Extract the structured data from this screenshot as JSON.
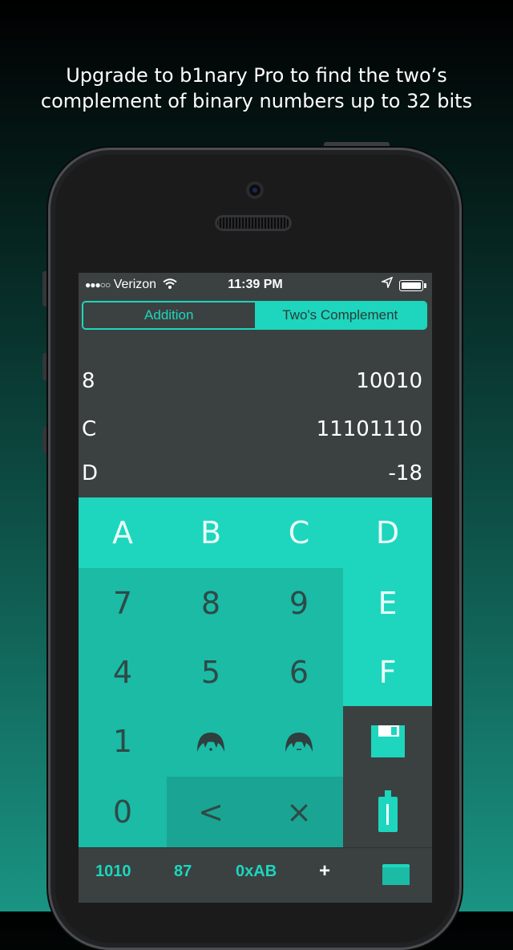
{
  "promo": {
    "line1": "Upgrade to b1nary Pro to find the two’s",
    "line2": "complement of binary numbers up to 32 bits"
  },
  "status_bar": {
    "signal": "●●●○○",
    "carrier": "Verizon",
    "time": "11:39 PM"
  },
  "segmented_control": {
    "options": [
      "Addition",
      "Two's Complement"
    ],
    "selected": "Two's Complement"
  },
  "rows": [
    {
      "label": "8",
      "value": "10010"
    },
    {
      "label": "C",
      "value": "11101110"
    },
    {
      "label": "D",
      "value": "-18"
    }
  ],
  "keypad": {
    "hex_keys": [
      "A",
      "B",
      "C",
      "D",
      "E",
      "F"
    ],
    "digit_keys": [
      "7",
      "8",
      "9",
      "4",
      "5",
      "6",
      "1",
      "0"
    ],
    "backspace": "<",
    "clear": "×"
  },
  "tab_bar": {
    "items": [
      "1010",
      "87",
      "0xAB",
      "+"
    ]
  },
  "colors": {
    "accent": "#1dd6bd",
    "digit_key": "#1bbba6",
    "screen_bg": "#3b4141"
  }
}
